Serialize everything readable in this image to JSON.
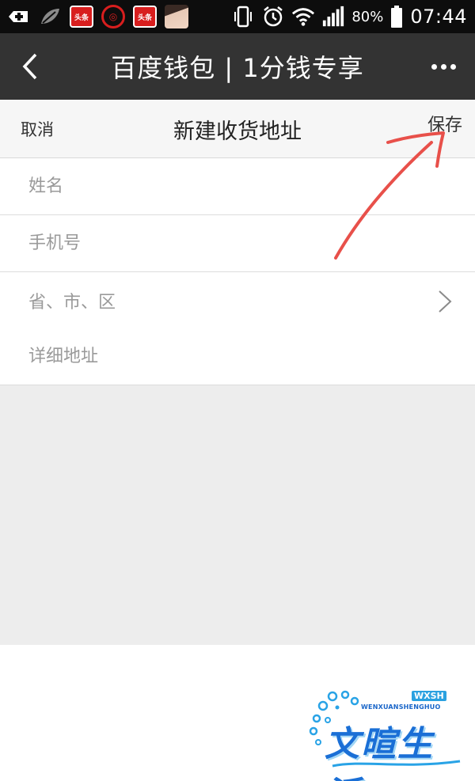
{
  "status_bar": {
    "app_badge_1": "头条",
    "app_badge_2": "头条",
    "battery": "80%",
    "time": "07:44"
  },
  "titlebar": {
    "title": "百度钱包 | 1分钱专享"
  },
  "form": {
    "cancel_label": "取消",
    "title": "新建收货地址",
    "save_label": "保存"
  },
  "fields": {
    "name_placeholder": "姓名",
    "phone_placeholder": "手机号",
    "region_label": "省、市、区",
    "address_placeholder": "详细地址"
  },
  "watermark": {
    "pinyin": "WENXUANSHENGHUO",
    "badge": "WXSH",
    "text": "文暄生活"
  },
  "colors": {
    "titlebar_bg": "#333333",
    "annotation": "#e8504a",
    "watermark": "#1a6fd6"
  }
}
